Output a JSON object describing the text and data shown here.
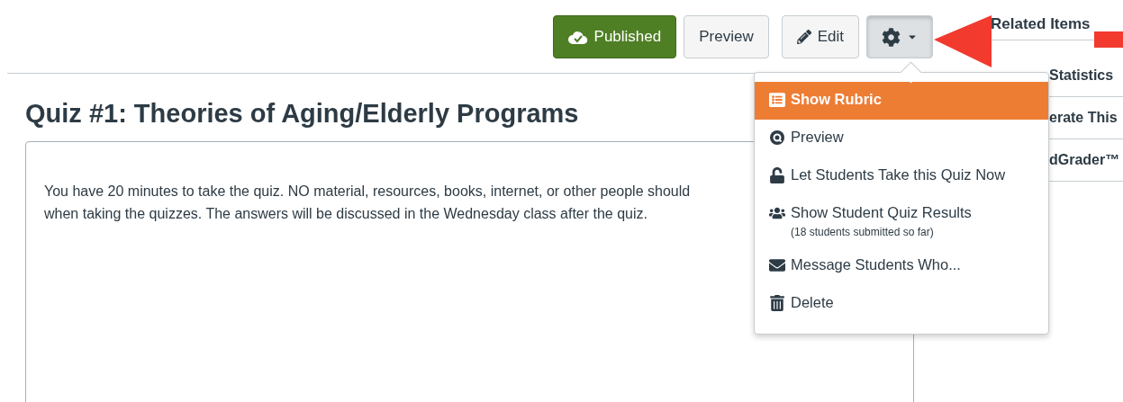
{
  "toolbar": {
    "published_button": {
      "label": "Published",
      "published": true
    },
    "preview_button": "Preview",
    "edit_button": "Edit",
    "settings_menu": {
      "expanded": true
    }
  },
  "quiz": {
    "title": "Quiz #1: Theories of Aging/Elderly Programs",
    "description": [
      "You have 20 minutes to take the quiz.  NO material, resources, books, internet, or other people should",
      "when taking the quizzes.  The answers will be discussed in the Wednesday class after the quiz."
    ]
  },
  "sidebar": {
    "heading": "Related Items",
    "items": [
      "Statistics",
      "erate This",
      "dGrader™"
    ]
  },
  "menu": [
    {
      "label": "Show Rubric",
      "selected": true
    },
    {
      "label": "Preview",
      "selected": false
    },
    {
      "label": "Let Students Take this Quiz Now",
      "selected": false
    },
    {
      "label": "Show Student Quiz Results",
      "note": "(18 students submitted so far)",
      "selected": false
    },
    {
      "label": "Message Students Who...",
      "selected": false
    },
    {
      "label": "Delete",
      "selected": false
    }
  ]
}
